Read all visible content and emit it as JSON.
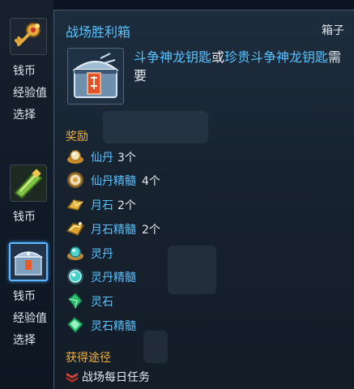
{
  "left": {
    "groups": [
      {
        "icon": "golden-key-icon",
        "lines": [
          "钱币",
          "经验值",
          "选择"
        ]
      },
      {
        "icon": "green-scroll-icon",
        "lines": [
          "钱币"
        ]
      },
      {
        "icon": "silver-chest-icon",
        "lines": [
          "钱币",
          "经验值",
          "选择"
        ],
        "selected": true
      }
    ]
  },
  "tooltip": {
    "title": "战场胜利箱",
    "type_label": "箱子",
    "item_icon": "silver-chest-icon",
    "requirement": {
      "key1": "斗争神龙钥匙",
      "or": "或",
      "key2": "珍贵斗争神龙钥匙",
      "suffix": "需要"
    },
    "rewards_heading": "奖励",
    "rewards": [
      {
        "name": "仙丹",
        "qty": "3个",
        "icon": "gold-pill-icon"
      },
      {
        "name": "仙丹精髓",
        "qty": "4个",
        "icon": "gold-essence-icon"
      },
      {
        "name": "月石",
        "qty": "2个",
        "icon": "gold-moonstone-icon"
      },
      {
        "name": "月石精髓",
        "qty": "2个",
        "icon": "gold-moonstone-essence-icon"
      },
      {
        "name": "灵丹",
        "qty": "",
        "icon": "teal-pill-icon"
      },
      {
        "name": "灵丹精髓",
        "qty": "",
        "icon": "teal-essence-icon"
      },
      {
        "name": "灵石",
        "qty": "",
        "icon": "green-crystal-icon"
      },
      {
        "name": "灵石精髓",
        "qty": "",
        "icon": "green-crystal-essence-icon"
      }
    ],
    "source_heading": "获得途径",
    "source": {
      "text": "战场每日任务",
      "icon": "battle-emblem-icon"
    }
  },
  "colors": {
    "title_blue": "#58c2ff",
    "heading_orange": "#f2b13a",
    "text_white": "#e4e9ef",
    "selected_border": "#5fb8ff"
  }
}
